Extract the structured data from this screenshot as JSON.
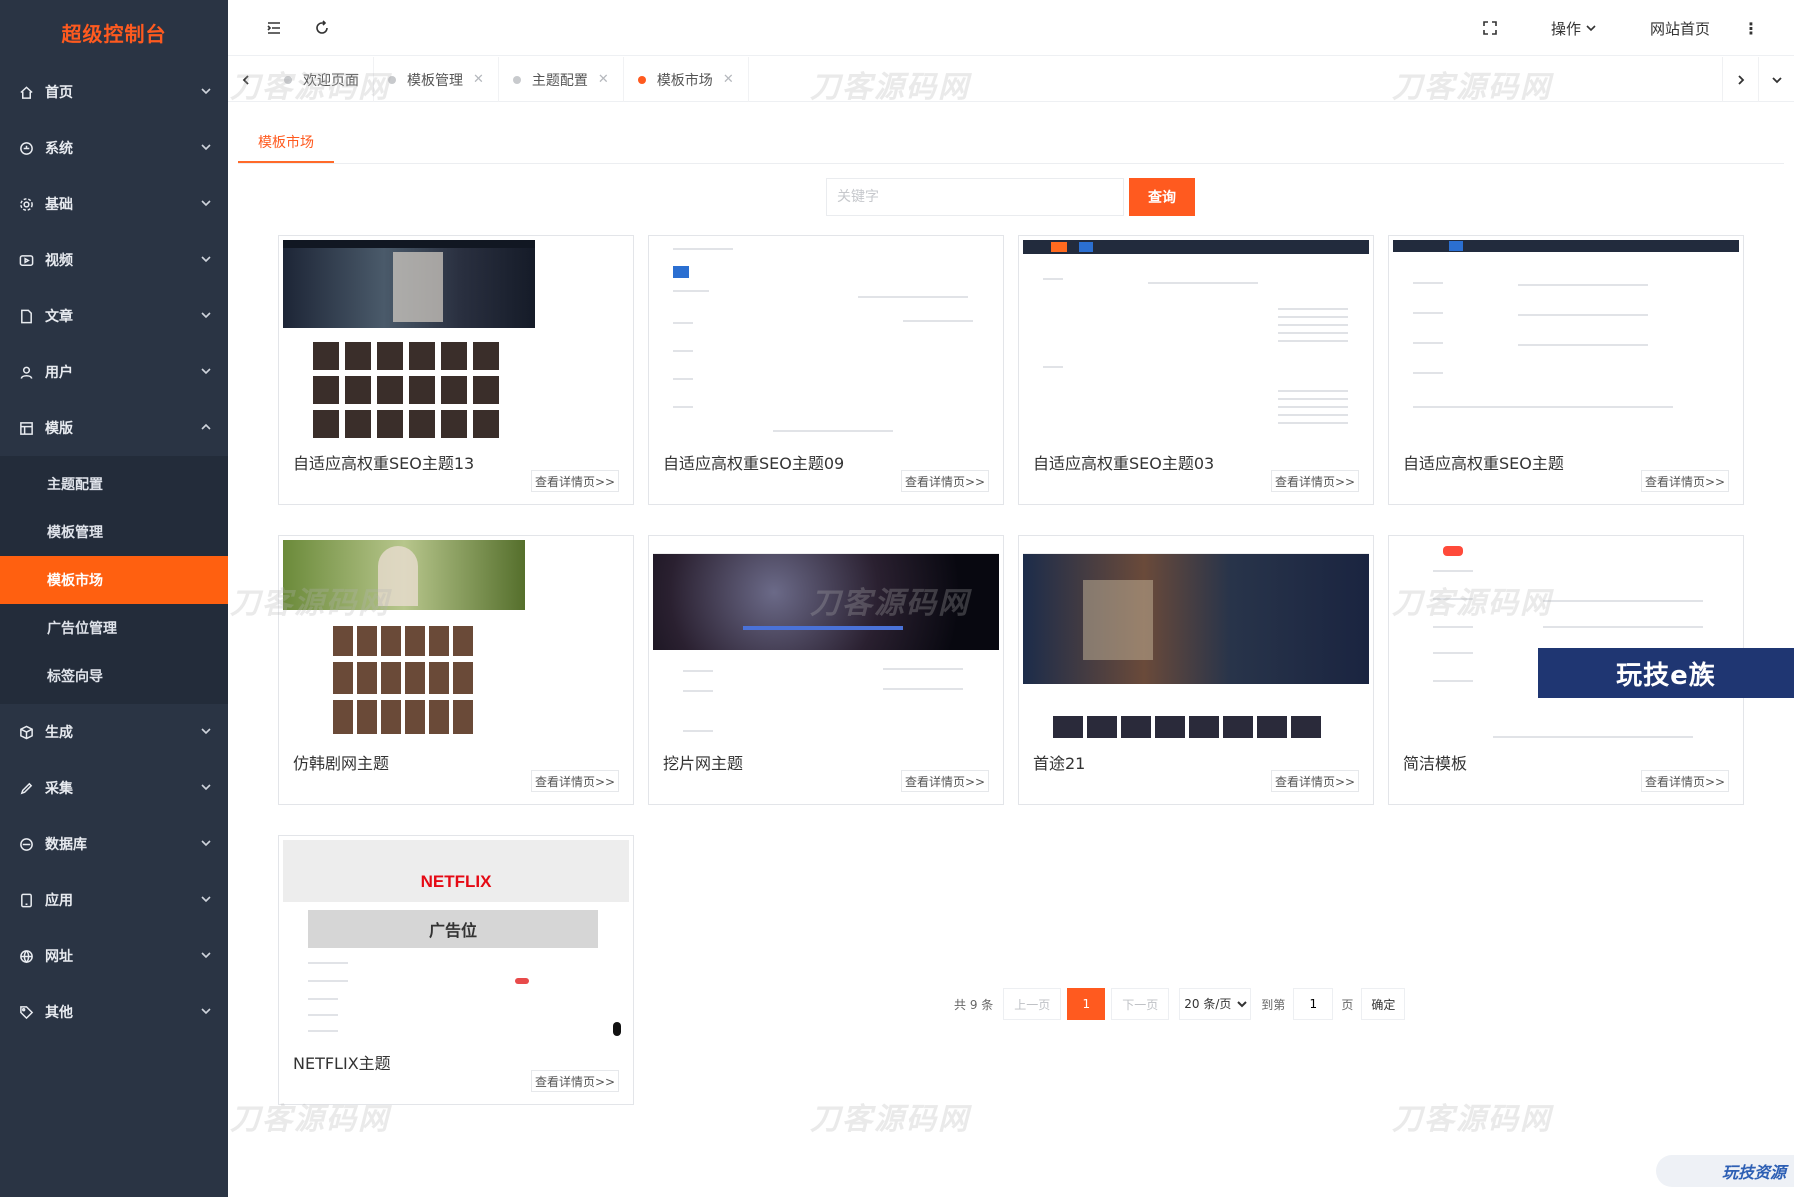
{
  "brand": "超级控制台",
  "sidebar": {
    "items": [
      {
        "label": "首页",
        "icon": "home-icon"
      },
      {
        "label": "系统",
        "icon": "system-icon"
      },
      {
        "label": "基础",
        "icon": "gear-icon"
      },
      {
        "label": "视频",
        "icon": "video-icon"
      },
      {
        "label": "文章",
        "icon": "document-icon"
      },
      {
        "label": "用户",
        "icon": "user-icon"
      },
      {
        "label": "模版",
        "icon": "template-icon"
      },
      {
        "label": "生成",
        "icon": "cube-icon"
      },
      {
        "label": "采集",
        "icon": "pen-icon"
      },
      {
        "label": "数据库",
        "icon": "database-icon"
      },
      {
        "label": "应用",
        "icon": "tablet-icon"
      },
      {
        "label": "网址",
        "icon": "globe-icon"
      },
      {
        "label": "其他",
        "icon": "tag-icon"
      }
    ],
    "submenu": [
      "主题配置",
      "模板管理",
      "模板市场",
      "广告位管理",
      "标签向导"
    ],
    "active_sub": "模板市场"
  },
  "topbar": {
    "operate_label": "操作",
    "site_home_label": "网站首页"
  },
  "tabs": [
    {
      "label": "欢迎页面"
    },
    {
      "label": "模板管理"
    },
    {
      "label": "主题配置"
    },
    {
      "label": "模板市场"
    }
  ],
  "page_tab": "模板市场",
  "search": {
    "placeholder": "关键字",
    "button": "查询"
  },
  "cards": [
    {
      "title": "自适应高权重SEO主题13",
      "detail": "查看详情页>>"
    },
    {
      "title": "自适应高权重SEO主题09",
      "detail": "查看详情页>>"
    },
    {
      "title": "自适应高权重SEO主题03",
      "detail": "查看详情页>>"
    },
    {
      "title": "自适应高权重SEO主题",
      "detail": "查看详情页>>"
    },
    {
      "title": "仿韩剧网主题",
      "detail": "查看详情页>>"
    },
    {
      "title": "挖片网主题",
      "detail": "查看详情页>>"
    },
    {
      "title": "首途21",
      "detail": "查看详情页>>"
    },
    {
      "title": "简洁模板",
      "detail": "查看详情页>>"
    },
    {
      "title": "NETFLIX主题",
      "detail": "查看详情页>>"
    }
  ],
  "thumb_text": {
    "netflix_logo": "NETFLIX",
    "ad_slot": "广告位"
  },
  "pager": {
    "total": "共 9 条",
    "prev": "上一页",
    "current": "1",
    "next": "下一页",
    "per_page": "20 条/页",
    "goto": "到第",
    "goto_value": "1",
    "page_unit": "页",
    "confirm": "确定"
  },
  "watermark": "刀客源码网",
  "overlay_badge": "玩技e族",
  "corner_badge": "玩技资源",
  "colors": {
    "accent": "#ff5a1f",
    "sidebar": "#2a3444"
  }
}
